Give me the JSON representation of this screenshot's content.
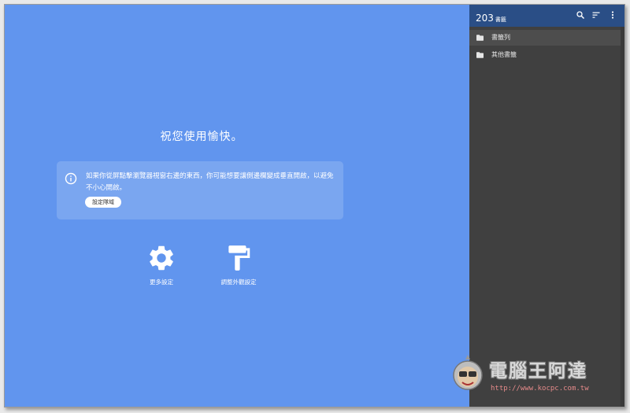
{
  "main": {
    "greeting": "祝您使用愉快。",
    "notice": {
      "text": "如果你從屏點擊瀏覽器視窗右邊的東西，你可能想要讓側邊欄變成垂直開啟，以避免不小心開啟。",
      "button_label": "設定隊域"
    },
    "shortcuts": [
      {
        "label": "更多設定",
        "icon": "gear-icon"
      },
      {
        "label": "調整外觀設定",
        "icon": "paint-roller-icon"
      }
    ]
  },
  "panel": {
    "header": {
      "count": "203",
      "unit": "書籤",
      "icons": [
        "search-icon",
        "sort-icon",
        "more-vert-icon"
      ]
    },
    "folders": [
      {
        "name": "書籤列",
        "icon": "folder-icon"
      },
      {
        "name": "其他書籤",
        "icon": "folder-icon"
      }
    ]
  },
  "watermark": {
    "title": "電腦王阿達",
    "url": "http://www.kocpc.com.tw"
  },
  "colors": {
    "main_bg": "#6195ee",
    "panel_bg": "#404040",
    "panel_header_bg": "#2a4e86"
  }
}
